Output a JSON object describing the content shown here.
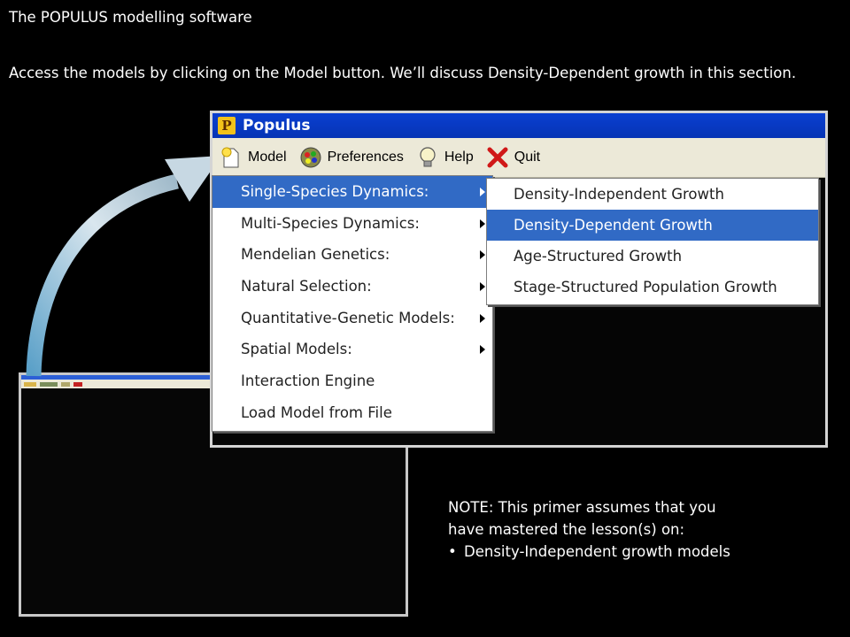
{
  "slide": {
    "title": "The POPULUS modelling software",
    "intro": "Access the models by clicking on the Model button.  We’ll discuss Density-Dependent growth in this section.",
    "note_line1": "NOTE:  This primer assumes that you",
    "note_line2": "have mastered the lesson(s) on:",
    "note_bullet": "Density-Independent growth models"
  },
  "window": {
    "title": "Populus",
    "logo_letter": "P"
  },
  "toolbar": {
    "model_label": "Model",
    "preferences_label": "Preferences",
    "help_label": "Help",
    "quit_label": "Quit"
  },
  "model_menu": {
    "items": [
      {
        "label": "Single-Species Dynamics:",
        "has_submenu": true,
        "selected": true
      },
      {
        "label": "Multi-Species Dynamics:",
        "has_submenu": true
      },
      {
        "label": "Mendelian Genetics:",
        "has_submenu": true
      },
      {
        "label": "Natural Selection:",
        "has_submenu": true
      },
      {
        "label": "Quantitative-Genetic Models:",
        "has_submenu": true
      },
      {
        "label": "Spatial Models:",
        "has_submenu": true
      },
      {
        "label": "Interaction Engine",
        "has_submenu": false
      },
      {
        "label": "Load Model from File",
        "has_submenu": false
      }
    ]
  },
  "single_species_submenu": {
    "items": [
      {
        "label": "Density-Independent Growth"
      },
      {
        "label": "Density-Dependent Growth",
        "selected": true
      },
      {
        "label": "Age-Structured Growth"
      },
      {
        "label": "Stage-Structured Population Growth"
      }
    ]
  },
  "colors": {
    "menu_highlight": "#316ac5",
    "titlebar": "#0a3fd1",
    "toolbar_bg": "#ece9d8"
  }
}
